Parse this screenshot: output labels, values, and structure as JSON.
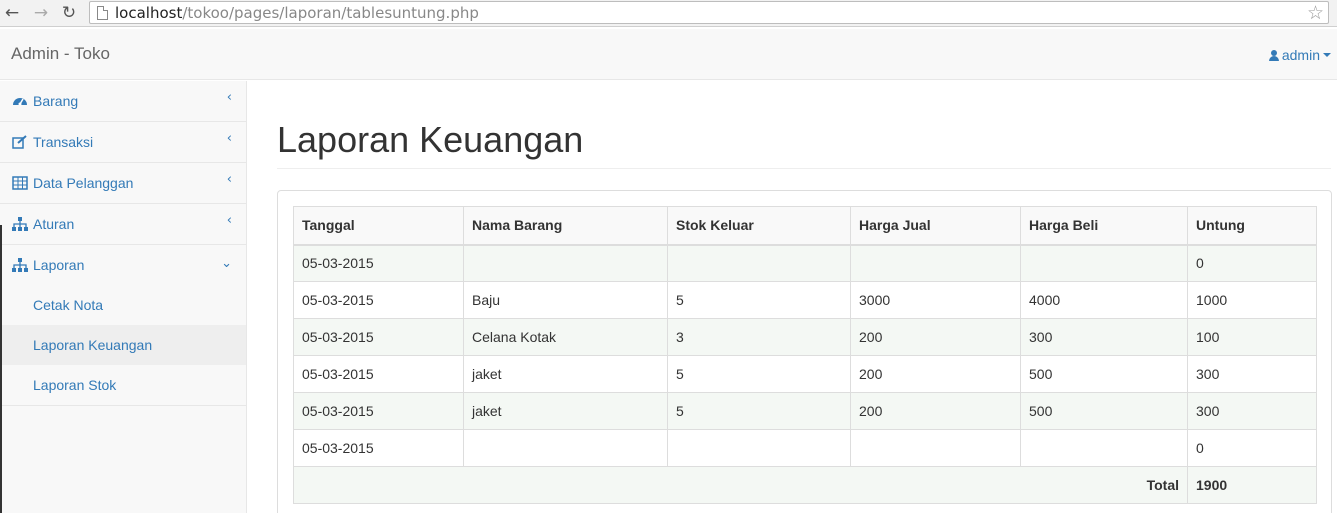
{
  "browser": {
    "url_host": "localhost",
    "url_path": "/tokoo/pages/laporan/tablesuntung.php"
  },
  "navbar": {
    "brand": "Admin - Toko",
    "user_label": "admin"
  },
  "sidebar": {
    "items": [
      {
        "label": "Barang",
        "icon": "dashboard-icon"
      },
      {
        "label": "Transaksi",
        "icon": "edit-icon"
      },
      {
        "label": "Data Pelanggan",
        "icon": "table-icon"
      },
      {
        "label": "Aturan",
        "icon": "sitemap-icon"
      },
      {
        "label": "Laporan",
        "icon": "sitemap-icon"
      }
    ],
    "subitems": [
      {
        "label": "Cetak Nota"
      },
      {
        "label": "Laporan Keuangan"
      },
      {
        "label": "Laporan Stok"
      }
    ]
  },
  "main": {
    "title": "Laporan Keuangan",
    "table": {
      "headers": [
        "Tanggal",
        "Nama Barang",
        "Stok Keluar",
        "Harga Jual",
        "Harga Beli",
        "Untung"
      ],
      "rows": [
        [
          "05-03-2015",
          "",
          "",
          "",
          "",
          "0"
        ],
        [
          "05-03-2015",
          "Baju",
          "5",
          "3000",
          "4000",
          "1000"
        ],
        [
          "05-03-2015",
          "Celana Kotak",
          "3",
          "200",
          "300",
          "100"
        ],
        [
          "05-03-2015",
          "jaket",
          "5",
          "200",
          "500",
          "300"
        ],
        [
          "05-03-2015",
          "jaket",
          "5",
          "200",
          "500",
          "300"
        ],
        [
          "05-03-2015",
          "",
          "",
          "",
          "",
          "0"
        ]
      ],
      "total_label": "Total",
      "total_value": "1900"
    }
  },
  "colors": {
    "link": "#337ab7",
    "striped_row": "#f4f8f4"
  }
}
